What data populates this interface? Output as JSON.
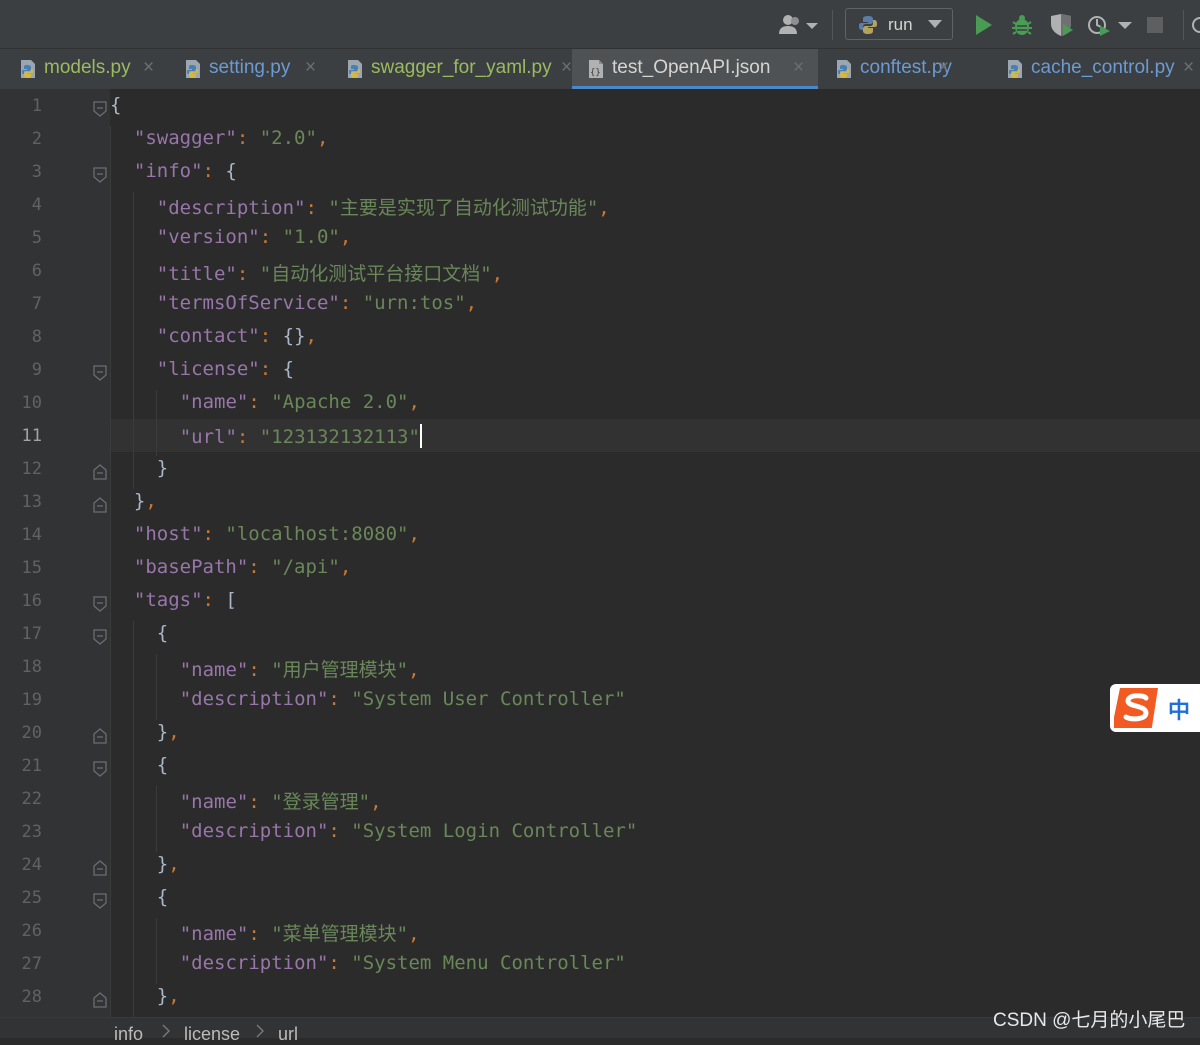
{
  "toolbar": {
    "run_config_label": "run",
    "icons": [
      "user-icon",
      "python-icon",
      "run-icon",
      "debug-icon",
      "coverage-icon",
      "profile-icon",
      "stop-icon"
    ]
  },
  "tabs": [
    {
      "label": "models.py",
      "icon": "python-file-icon",
      "active": false
    },
    {
      "label": "setting.py",
      "icon": "python-file-icon",
      "active": false
    },
    {
      "label": "swagger_for_yaml.py",
      "icon": "python-file-icon",
      "active": false
    },
    {
      "label": "test_OpenAPI.json",
      "icon": "json-file-icon",
      "active": true
    },
    {
      "label": "conftest.py",
      "icon": "python-file-icon",
      "active": false
    },
    {
      "label": "cache_control.py",
      "icon": "python-file-icon",
      "active": false
    }
  ],
  "tab_close_glyph": "×",
  "editor": {
    "current_line": 11,
    "line_numbers": [
      "1",
      "2",
      "3",
      "4",
      "5",
      "6",
      "7",
      "8",
      "9",
      "10",
      "11",
      "12",
      "13",
      "14",
      "15",
      "16",
      "17",
      "18",
      "19",
      "20",
      "21",
      "22",
      "23",
      "24",
      "25",
      "26",
      "27",
      "28"
    ],
    "lines": [
      [
        {
          "t": "b",
          "v": "{"
        }
      ],
      [
        {
          "t": "k",
          "v": "\"swagger\""
        },
        {
          "t": "p",
          "v": ": "
        },
        {
          "t": "s",
          "v": "\"2.0\""
        },
        {
          "t": "p",
          "v": ","
        }
      ],
      [
        {
          "t": "k",
          "v": "\"info\""
        },
        {
          "t": "p",
          "v": ": "
        },
        {
          "t": "b",
          "v": "{"
        }
      ],
      [
        {
          "t": "k",
          "v": "\"description\""
        },
        {
          "t": "p",
          "v": ": "
        },
        {
          "t": "s",
          "v": "\"主要是实现了自动化测试功能\""
        },
        {
          "t": "p",
          "v": ","
        }
      ],
      [
        {
          "t": "k",
          "v": "\"version\""
        },
        {
          "t": "p",
          "v": ": "
        },
        {
          "t": "s",
          "v": "\"1.0\""
        },
        {
          "t": "p",
          "v": ","
        }
      ],
      [
        {
          "t": "k",
          "v": "\"title\""
        },
        {
          "t": "p",
          "v": ": "
        },
        {
          "t": "s",
          "v": "\"自动化测试平台接口文档\""
        },
        {
          "t": "p",
          "v": ","
        }
      ],
      [
        {
          "t": "k",
          "v": "\"termsOfService\""
        },
        {
          "t": "p",
          "v": ": "
        },
        {
          "t": "s",
          "v": "\"urn:tos\""
        },
        {
          "t": "p",
          "v": ","
        }
      ],
      [
        {
          "t": "k",
          "v": "\"contact\""
        },
        {
          "t": "p",
          "v": ": "
        },
        {
          "t": "b",
          "v": "{}"
        },
        {
          "t": "p",
          "v": ","
        }
      ],
      [
        {
          "t": "k",
          "v": "\"license\""
        },
        {
          "t": "p",
          "v": ": "
        },
        {
          "t": "b",
          "v": "{"
        }
      ],
      [
        {
          "t": "k",
          "v": "\"name\""
        },
        {
          "t": "p",
          "v": ": "
        },
        {
          "t": "s",
          "v": "\"Apache 2.0\""
        },
        {
          "t": "p",
          "v": ","
        }
      ],
      [
        {
          "t": "k",
          "v": "\"url\""
        },
        {
          "t": "p",
          "v": ": "
        },
        {
          "t": "s",
          "v": "\"123132132113\""
        }
      ],
      [
        {
          "t": "b",
          "v": "}"
        }
      ],
      [
        {
          "t": "b",
          "v": "}"
        },
        {
          "t": "p",
          "v": ","
        }
      ],
      [
        {
          "t": "k",
          "v": "\"host\""
        },
        {
          "t": "p",
          "v": ": "
        },
        {
          "t": "s",
          "v": "\"localhost:8080\""
        },
        {
          "t": "p",
          "v": ","
        }
      ],
      [
        {
          "t": "k",
          "v": "\"basePath\""
        },
        {
          "t": "p",
          "v": ": "
        },
        {
          "t": "s",
          "v": "\"/api\""
        },
        {
          "t": "p",
          "v": ","
        }
      ],
      [
        {
          "t": "k",
          "v": "\"tags\""
        },
        {
          "t": "p",
          "v": ": "
        },
        {
          "t": "b",
          "v": "["
        }
      ],
      [
        {
          "t": "b",
          "v": "{"
        }
      ],
      [
        {
          "t": "k",
          "v": "\"name\""
        },
        {
          "t": "p",
          "v": ": "
        },
        {
          "t": "s",
          "v": "\"用户管理模块\""
        },
        {
          "t": "p",
          "v": ","
        }
      ],
      [
        {
          "t": "k",
          "v": "\"description\""
        },
        {
          "t": "p",
          "v": ": "
        },
        {
          "t": "s",
          "v": "\"System User Controller\""
        }
      ],
      [
        {
          "t": "b",
          "v": "}"
        },
        {
          "t": "p",
          "v": ","
        }
      ],
      [
        {
          "t": "b",
          "v": "{"
        }
      ],
      [
        {
          "t": "k",
          "v": "\"name\""
        },
        {
          "t": "p",
          "v": ": "
        },
        {
          "t": "s",
          "v": "\"登录管理\""
        },
        {
          "t": "p",
          "v": ","
        }
      ],
      [
        {
          "t": "k",
          "v": "\"description\""
        },
        {
          "t": "p",
          "v": ": "
        },
        {
          "t": "s",
          "v": "\"System Login Controller\""
        }
      ],
      [
        {
          "t": "b",
          "v": "}"
        },
        {
          "t": "p",
          "v": ","
        }
      ],
      [
        {
          "t": "b",
          "v": "{"
        }
      ],
      [
        {
          "t": "k",
          "v": "\"name\""
        },
        {
          "t": "p",
          "v": ": "
        },
        {
          "t": "s",
          "v": "\"菜单管理模块\""
        },
        {
          "t": "p",
          "v": ","
        }
      ],
      [
        {
          "t": "k",
          "v": "\"description\""
        },
        {
          "t": "p",
          "v": ": "
        },
        {
          "t": "s",
          "v": "\"System Menu Controller\""
        }
      ],
      [
        {
          "t": "b",
          "v": "}"
        },
        {
          "t": "p",
          "v": ","
        }
      ]
    ]
  },
  "ime": {
    "mode": "中"
  },
  "breadcrumb": [
    "info",
    "license",
    "url"
  ],
  "watermark": "CSDN @七月的小尾巴",
  "colors": {
    "key": "#9876aa",
    "string": "#6a8759",
    "punctuation": "#cc7832",
    "bracket": "#a9b7c6",
    "background": "#2b2b2b",
    "active_tab_underline": "#4a88c7"
  }
}
